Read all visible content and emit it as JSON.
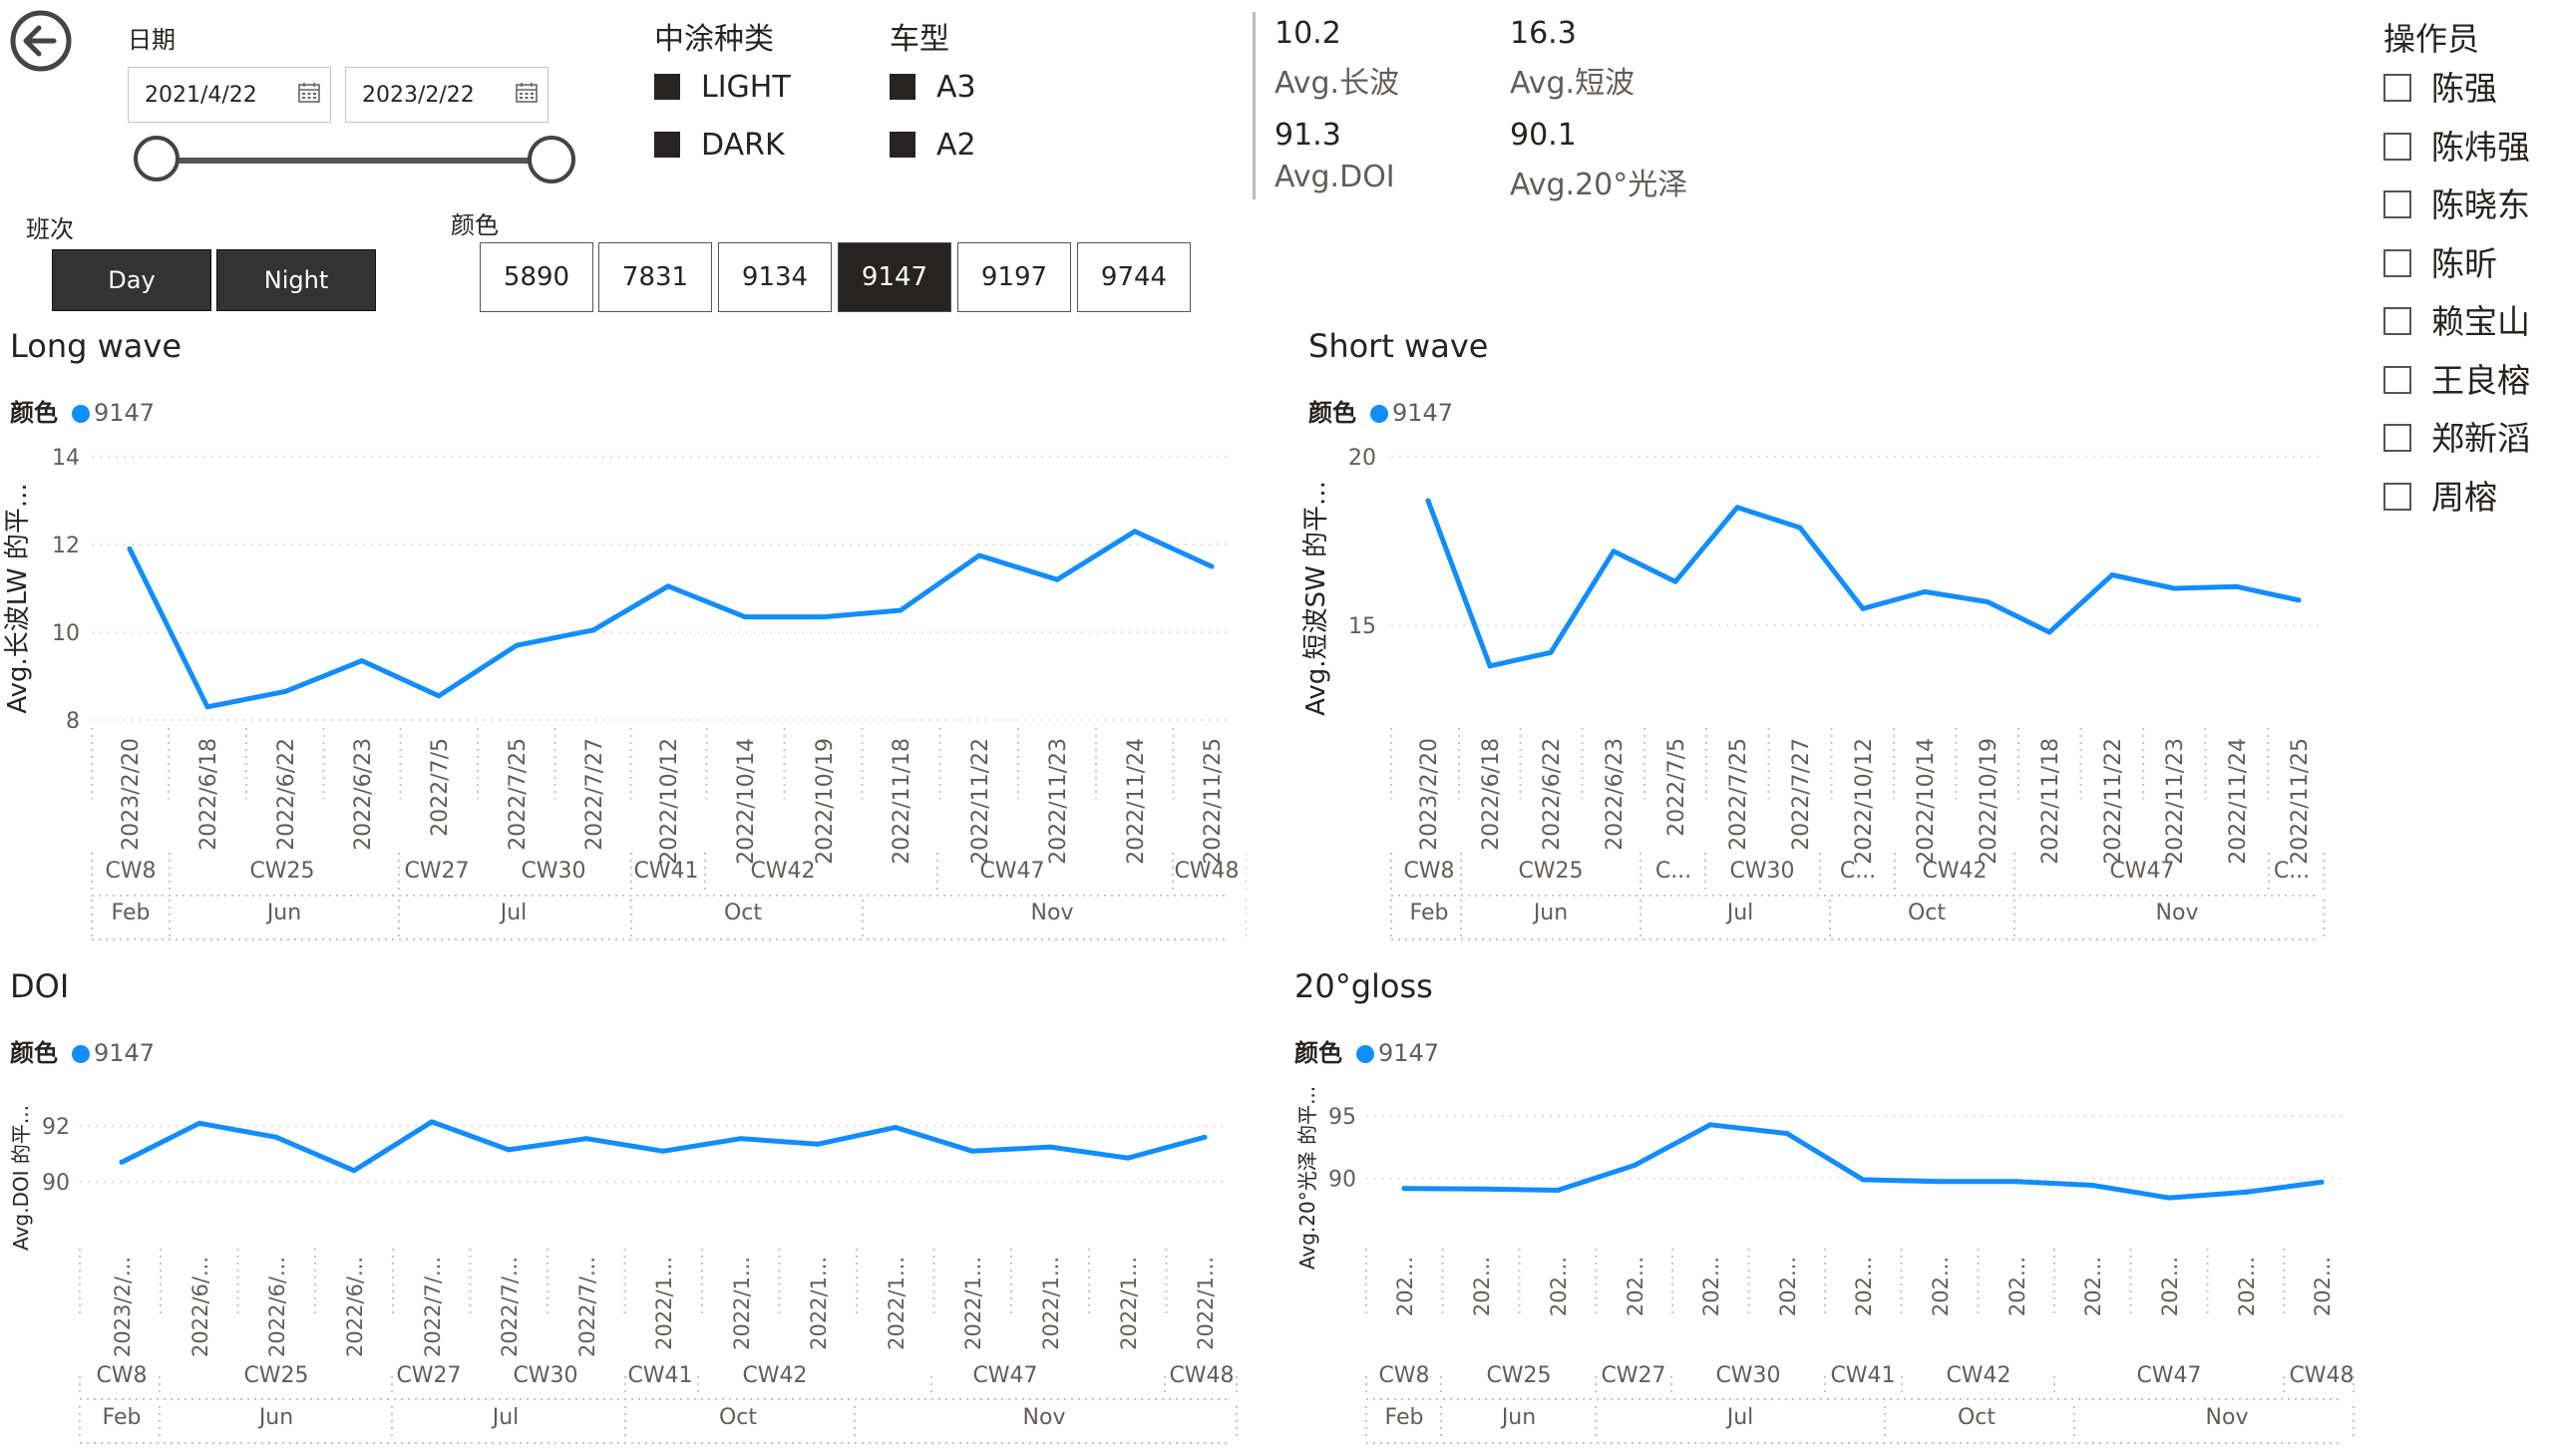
{
  "back_icon": "arrow-left-circle-icon",
  "date_filter": {
    "label": "日期",
    "start": "2021/4/22",
    "end": "2023/2/22",
    "calendar_icon": "calendar-icon"
  },
  "shift_filter": {
    "label": "班次",
    "options": [
      "Day",
      "Night"
    ]
  },
  "color_filter": {
    "label": "颜色",
    "options": [
      "5890",
      "7831",
      "9134",
      "9147",
      "9197",
      "9744"
    ],
    "selected": "9147"
  },
  "coating_filter": {
    "label": "中涂种类",
    "options": [
      "LIGHT",
      "DARK"
    ]
  },
  "model_filter": {
    "label": "车型",
    "options": [
      "A3",
      "A2"
    ]
  },
  "kpis": {
    "long_wave": {
      "value": "10.2",
      "label": "Avg.长波"
    },
    "short_wave": {
      "value": "16.3",
      "label": "Avg.短波"
    },
    "doi": {
      "value": "91.3",
      "label": "Avg.DOI"
    },
    "gloss": {
      "value": "90.1",
      "label": "Avg.20°光泽"
    }
  },
  "operator_filter": {
    "label": "操作员",
    "options": [
      "陈强",
      "陈炜强",
      "陈晓东",
      "陈昕",
      "赖宝山",
      "王良榕",
      "郑新滔",
      "周榕"
    ]
  },
  "legend": {
    "field": "颜色",
    "value": "9147",
    "color": "#118dff"
  },
  "chart_data": [
    {
      "type": "line",
      "title": "Long wave",
      "ylabel": "Avg.长波LW 的平...",
      "yticks": [
        "14",
        "12",
        "10",
        "8"
      ],
      "ylim": [
        8,
        14
      ],
      "x": [
        "2023/2/20",
        "2022/6/18",
        "2022/6/22",
        "2022/6/23",
        "2022/7/5",
        "2022/7/25",
        "2022/7/27",
        "2022/10/12",
        "2022/10/14",
        "2022/10/19",
        "2022/11/18",
        "2022/11/22",
        "2022/11/23",
        "2022/11/24",
        "2022/11/25"
      ],
      "values": [
        11.9,
        8.3,
        8.65,
        9.35,
        8.55,
        9.7,
        10.05,
        11.05,
        10.35,
        10.35,
        10.5,
        11.75,
        11.2,
        12.3,
        11.5
      ],
      "week_labels": [
        "CW8",
        "CW25",
        "CW27",
        "CW30",
        "CW41",
        "CW42",
        "CW47",
        "CW48"
      ],
      "month_labels": [
        "Feb",
        "Jun",
        "Jul",
        "Oct",
        "Nov"
      ]
    },
    {
      "type": "line",
      "title": "Short wave",
      "ylabel": "Avg.短波SW 的平...",
      "yticks": [
        "20",
        "15"
      ],
      "ylim": [
        12.2,
        20
      ],
      "x": [
        "2023/2/20",
        "2022/6/18",
        "2022/6/22",
        "2022/6/23",
        "2022/7/5",
        "2022/7/25",
        "2022/7/27",
        "2022/10/12",
        "2022/10/14",
        "2022/10/19",
        "2022/11/18",
        "2022/11/22",
        "2022/11/23",
        "2022/11/24",
        "2022/11/25"
      ],
      "values": [
        18.7,
        13.8,
        14.2,
        17.2,
        16.3,
        18.5,
        17.9,
        15.5,
        16.0,
        15.7,
        14.8,
        16.5,
        16.1,
        16.15,
        15.75
      ],
      "week_labels": [
        "CW8",
        "CW25",
        "C...",
        "CW30",
        "C...",
        "CW42",
        "CW47",
        "C..."
      ],
      "month_labels": [
        "Feb",
        "Jun",
        "Jul",
        "Oct",
        "Nov"
      ]
    },
    {
      "type": "line",
      "title": "DOI",
      "ylabel": "Avg.DOI 的平...",
      "yticks": [
        "92",
        "90"
      ],
      "ylim": [
        88.1,
        92.9
      ],
      "x": [
        "2023/2/...",
        "2022/6/...",
        "2022/6/...",
        "2022/6/...",
        "2022/7/...",
        "2022/7/...",
        "2022/7/...",
        "2022/1...",
        "2022/1...",
        "2022/1...",
        "2022/1...",
        "2022/1...",
        "2022/1...",
        "2022/1...",
        "2022/1..."
      ],
      "values": [
        90.7,
        92.1,
        91.6,
        90.4,
        92.15,
        91.15,
        91.55,
        91.1,
        91.55,
        91.35,
        91.95,
        91.1,
        91.25,
        90.85,
        91.6
      ],
      "week_labels": [
        "CW8",
        "CW25",
        "CW27",
        "CW30",
        "CW41",
        "CW42",
        "CW47",
        "CW48"
      ],
      "month_labels": [
        "Feb",
        "Jun",
        "Jul",
        "Oct",
        "Nov"
      ]
    },
    {
      "type": "line",
      "title": "20°gloss",
      "ylabel": "Avg.20°光泽 的平...",
      "yticks": [
        "95",
        "90"
      ],
      "ylim": [
        85.5,
        96.2
      ],
      "x": [
        "202...",
        "202...",
        "202...",
        "202...",
        "202...",
        "202...",
        "202...",
        "202...",
        "202...",
        "202...",
        "202...",
        "202...",
        "202..."
      ],
      "values": [
        89.2,
        89.15,
        89.05,
        91.05,
        94.3,
        93.6,
        89.9,
        89.75,
        89.75,
        89.45,
        88.45,
        88.9,
        89.7
      ],
      "week_labels": [
        "CW8",
        "CW25",
        "CW27",
        "CW30",
        "CW41",
        "CW42",
        "CW47",
        "CW48"
      ],
      "month_labels": [
        "Feb",
        "Jun",
        "Jul",
        "Oct",
        "Nov"
      ]
    }
  ]
}
